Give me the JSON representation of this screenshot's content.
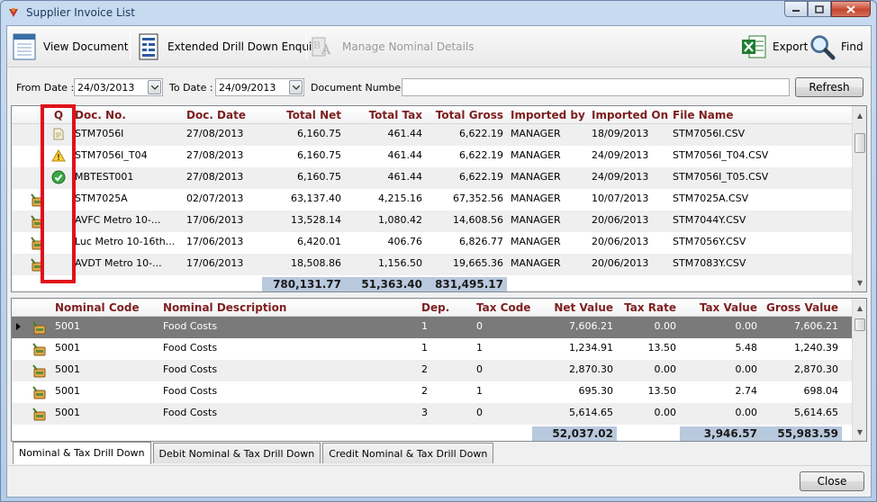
{
  "window": {
    "title": "Supplier Invoice List",
    "accent": "#1e395b"
  },
  "toolbar": {
    "view_document": "View Document",
    "extended_drill_down": "Extended Drill Down Enquiry",
    "manage_nominal": "Manage Nominal Details",
    "export": "Export",
    "find": "Find"
  },
  "filters": {
    "from_label": "From Date :",
    "from_value": "24/03/2013",
    "to_label": "To Date :",
    "to_value": "24/09/2013",
    "docnum_label": "Document Number :",
    "docnum_value": "",
    "refresh": "Refresh"
  },
  "invoices": {
    "headers": [
      "Q",
      "Doc. No.",
      "Doc. Date",
      "Total Net",
      "Total Tax",
      "Total Gross",
      "Imported by",
      "Imported On",
      "File Name"
    ],
    "rows": [
      {
        "q_icon": "document-icon",
        "row_icon": "",
        "doc_no": "STM7056I",
        "doc_date": "27/08/2013",
        "net": "6,160.75",
        "tax": "461.44",
        "gross": "6,622.19",
        "by": "MANAGER",
        "on": "18/09/2013",
        "file": "STM7056I.CSV"
      },
      {
        "q_icon": "warning-icon",
        "row_icon": "",
        "doc_no": "STM7056I_T04",
        "doc_date": "27/08/2013",
        "net": "6,160.75",
        "tax": "461.44",
        "gross": "6,622.19",
        "by": "MANAGER",
        "on": "24/09/2013",
        "file": "STM7056I_T04.CSV"
      },
      {
        "q_icon": "check-icon",
        "row_icon": "",
        "doc_no": "MBTEST001",
        "doc_date": "27/08/2013",
        "net": "6,160.75",
        "tax": "461.44",
        "gross": "6,622.19",
        "by": "MANAGER",
        "on": "24/09/2013",
        "file": "STM7056I_T05.CSV"
      },
      {
        "q_icon": "",
        "row_icon": "drilldown-icon",
        "doc_no": "STM7025A",
        "doc_date": "02/07/2013",
        "net": "63,137.40",
        "tax": "4,215.16",
        "gross": "67,352.56",
        "by": "MANAGER",
        "on": "10/07/2013",
        "file": "STM7025A.CSV"
      },
      {
        "q_icon": "",
        "row_icon": "drilldown-icon",
        "doc_no": "AVFC Metro 10-...",
        "doc_date": "17/06/2013",
        "net": "13,528.14",
        "tax": "1,080.42",
        "gross": "14,608.56",
        "by": "MANAGER",
        "on": "20/06/2013",
        "file": "STM7044Y.CSV"
      },
      {
        "q_icon": "",
        "row_icon": "drilldown-icon",
        "doc_no": "Luc Metro 10-16th...",
        "doc_date": "17/06/2013",
        "net": "6,420.01",
        "tax": "406.76",
        "gross": "6,826.77",
        "by": "MANAGER",
        "on": "20/06/2013",
        "file": "STM7056Y.CSV"
      },
      {
        "q_icon": "",
        "row_icon": "drilldown-icon",
        "doc_no": "AVDT Metro 10-...",
        "doc_date": "17/06/2013",
        "net": "18,508.86",
        "tax": "1,156.50",
        "gross": "19,665.36",
        "by": "MANAGER",
        "on": "20/06/2013",
        "file": "STM7083Y.CSV"
      }
    ],
    "totals": {
      "net": "780,131.77",
      "tax": "51,363.40",
      "gross": "831,495.17"
    }
  },
  "nominals": {
    "headers": [
      "Nominal Code",
      "Nominal Description",
      "Dep.",
      "Tax Code",
      "Net Value",
      "Tax Rate",
      "Tax Value",
      "Gross Value"
    ],
    "rows": [
      {
        "code": "5001",
        "desc": "Food Costs",
        "dep": "1",
        "taxcode": "0",
        "net": "7,606.21",
        "rate": "0.00",
        "taxval": "0.00",
        "gross": "7,606.21"
      },
      {
        "code": "5001",
        "desc": "Food Costs",
        "dep": "1",
        "taxcode": "1",
        "net": "1,234.91",
        "rate": "13.50",
        "taxval": "5.48",
        "gross": "1,240.39"
      },
      {
        "code": "5001",
        "desc": "Food Costs",
        "dep": "2",
        "taxcode": "0",
        "net": "2,870.30",
        "rate": "0.00",
        "taxval": "0.00",
        "gross": "2,870.30"
      },
      {
        "code": "5001",
        "desc": "Food Costs",
        "dep": "2",
        "taxcode": "1",
        "net": "695.30",
        "rate": "13.50",
        "taxval": "2.74",
        "gross": "698.04"
      },
      {
        "code": "5001",
        "desc": "Food Costs",
        "dep": "3",
        "taxcode": "0",
        "net": "5,614.65",
        "rate": "0.00",
        "taxval": "0.00",
        "gross": "5,614.65"
      }
    ],
    "totals": {
      "net": "52,037.02",
      "taxval": "3,946.57",
      "gross": "55,983.59"
    }
  },
  "tabs": [
    "Nominal & Tax Drill Down",
    "Debit Nominal & Tax Drill Down",
    "Credit Nominal & Tax Drill Down"
  ],
  "close": "Close",
  "colors": {
    "header_text": "#7d1f1f",
    "selected_row": "#7a7a7a",
    "totals_bg": "#b9c9dd",
    "highlight": "#e0101a"
  }
}
